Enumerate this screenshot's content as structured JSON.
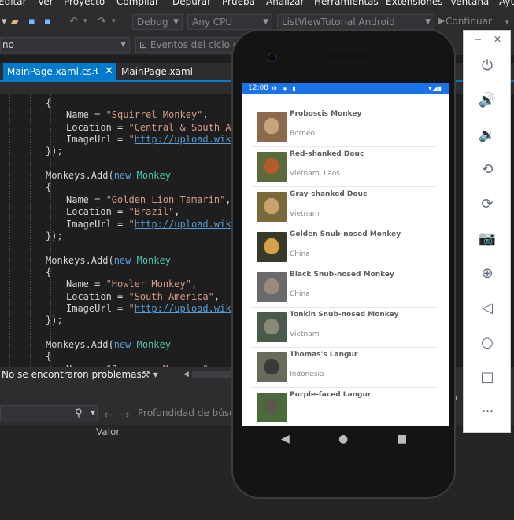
{
  "menubar": {
    "items": [
      "Editar",
      "Ver",
      "Proyecto",
      "Compilar",
      "Depurar",
      "Prueba",
      "Analizar",
      "Herramientas",
      "Extensiones",
      "Ventana",
      "Ayuda"
    ]
  },
  "toolbar": {
    "config": "Debug",
    "platform": "Any CPU",
    "startup_project": "ListViewTutorial.Android",
    "continue_label": "Continuar"
  },
  "navbar": {
    "scope": "no",
    "events": "Eventos del ciclo de"
  },
  "tabs": {
    "active": "MainPage.xaml.cs",
    "pin": "ⴼ",
    "close": "✕",
    "inactive": "MainPage.xaml"
  },
  "code": {
    "lines": [
      {
        "indent": 2,
        "tokens": [
          {
            "c": "c-punc",
            "t": "{"
          }
        ]
      },
      {
        "indent": 3,
        "tokens": [
          {
            "c": "c-punc",
            "t": "Name = "
          },
          {
            "c": "c-str",
            "t": "\"Squirrel Monkey\""
          },
          {
            "c": "c-punc",
            "t": ","
          }
        ]
      },
      {
        "indent": 3,
        "tokens": [
          {
            "c": "c-punc",
            "t": "Location = "
          },
          {
            "c": "c-str",
            "t": "\"Central & South Ameri"
          }
        ]
      },
      {
        "indent": 3,
        "tokens": [
          {
            "c": "c-punc",
            "t": "ImageUrl = "
          },
          {
            "c": "c-str",
            "t": "\""
          },
          {
            "c": "c-link",
            "t": "http://upload.wikimed"
          }
        ]
      },
      {
        "indent": 2,
        "tokens": [
          {
            "c": "c-punc",
            "t": "});"
          }
        ]
      },
      {
        "indent": 0,
        "tokens": []
      },
      {
        "indent": 2,
        "tokens": [
          {
            "c": "c-punc",
            "t": "Monkeys.Add("
          },
          {
            "c": "c-kw",
            "t": "new"
          },
          {
            "c": "c-punc",
            "t": " "
          },
          {
            "c": "c-type",
            "t": "Monkey"
          }
        ]
      },
      {
        "indent": 2,
        "tokens": [
          {
            "c": "c-punc",
            "t": "{"
          }
        ]
      },
      {
        "indent": 3,
        "tokens": [
          {
            "c": "c-punc",
            "t": "Name = "
          },
          {
            "c": "c-str",
            "t": "\"Golden Lion Tamarin\""
          },
          {
            "c": "c-punc",
            "t": ","
          }
        ]
      },
      {
        "indent": 3,
        "tokens": [
          {
            "c": "c-punc",
            "t": "Location = "
          },
          {
            "c": "c-str",
            "t": "\"Brazil\""
          },
          {
            "c": "c-punc",
            "t": ","
          }
        ]
      },
      {
        "indent": 3,
        "tokens": [
          {
            "c": "c-punc",
            "t": "ImageUrl = "
          },
          {
            "c": "c-str",
            "t": "\""
          },
          {
            "c": "c-link",
            "t": "http://upload.wikimed"
          }
        ]
      },
      {
        "indent": 2,
        "tokens": [
          {
            "c": "c-punc",
            "t": "});"
          }
        ]
      },
      {
        "indent": 0,
        "tokens": []
      },
      {
        "indent": 2,
        "tokens": [
          {
            "c": "c-punc",
            "t": "Monkeys.Add("
          },
          {
            "c": "c-kw",
            "t": "new"
          },
          {
            "c": "c-punc",
            "t": " "
          },
          {
            "c": "c-type",
            "t": "Monkey"
          }
        ]
      },
      {
        "indent": 2,
        "tokens": [
          {
            "c": "c-punc",
            "t": "{"
          }
        ]
      },
      {
        "indent": 3,
        "tokens": [
          {
            "c": "c-punc",
            "t": "Name = "
          },
          {
            "c": "c-str",
            "t": "\"Howler Monkey\""
          },
          {
            "c": "c-punc",
            "t": ","
          }
        ]
      },
      {
        "indent": 3,
        "tokens": [
          {
            "c": "c-punc",
            "t": "Location = "
          },
          {
            "c": "c-str",
            "t": "\"South America\""
          },
          {
            "c": "c-punc",
            "t": ","
          }
        ]
      },
      {
        "indent": 3,
        "tokens": [
          {
            "c": "c-punc",
            "t": "ImageUrl = "
          },
          {
            "c": "c-str",
            "t": "\""
          },
          {
            "c": "c-link",
            "t": "http://upload.wikimed"
          }
        ]
      },
      {
        "indent": 2,
        "tokens": [
          {
            "c": "c-punc",
            "t": "});"
          }
        ]
      },
      {
        "indent": 0,
        "tokens": []
      },
      {
        "indent": 2,
        "tokens": [
          {
            "c": "c-punc",
            "t": "Monkeys.Add("
          },
          {
            "c": "c-kw",
            "t": "new"
          },
          {
            "c": "c-punc",
            "t": " "
          },
          {
            "c": "c-type",
            "t": "Monkey"
          }
        ]
      },
      {
        "indent": 2,
        "tokens": [
          {
            "c": "c-punc",
            "t": "{"
          }
        ]
      },
      {
        "indent": 3,
        "tokens": [
          {
            "c": "c-punc",
            "t": "Name = "
          },
          {
            "c": "c-str",
            "t": "\"Japanese Macaque\""
          },
          {
            "c": "c-punc",
            "t": ","
          }
        ]
      }
    ]
  },
  "status": {
    "message": "No se encontraron problemas.",
    "brush_icon": "brush-icon"
  },
  "lower_panel": {
    "search_icon": "search-icon",
    "back_icon": "←",
    "forward_icon": "→",
    "depth_label": "Profundidad de búsqu",
    "value_header": "Valor"
  },
  "phone": {
    "time": "12:08",
    "colors": {
      "statusbar": "#1a73e8"
    },
    "monkeys": [
      {
        "name": "Proboscis Monkey",
        "location": "Borneo",
        "bg": "#8a6a4a",
        "face": "#c7a27a"
      },
      {
        "name": "Red-shanked Douc",
        "location": "Vietnam, Laos",
        "bg": "#5a6a3a",
        "face": "#b55a2a"
      },
      {
        "name": "Gray-shanked Douc",
        "location": "Vietnam",
        "bg": "#7a6a3a",
        "face": "#c9a36a"
      },
      {
        "name": "Golden Snub-nosed Monkey",
        "location": "China",
        "bg": "#3a3a2a",
        "face": "#d4a24a"
      },
      {
        "name": "Black Snub-nosed Monkey",
        "location": "China",
        "bg": "#6a6a6a",
        "face": "#9a8a7a"
      },
      {
        "name": "Tonkin Snub-nosed Monkey",
        "location": "Vietnam",
        "bg": "#4a5a4a",
        "face": "#8a8a7a"
      },
      {
        "name": "Thomas's Langur",
        "location": "Indonesia",
        "bg": "#6a6a5a",
        "face": "#3a3a3a"
      },
      {
        "name": "Purple-faced Langur",
        "location": "",
        "bg": "#4a6a3a",
        "face": "#5a5a4a"
      }
    ]
  },
  "emulator": {
    "minimize": "−",
    "close": "✕",
    "buttons": [
      {
        "name": "power-icon",
        "glyph": "⏻"
      },
      {
        "name": "volume-up-icon",
        "glyph": "🔊"
      },
      {
        "name": "volume-down-icon",
        "glyph": "🔉"
      },
      {
        "name": "rotate-left-icon",
        "glyph": "⟲"
      },
      {
        "name": "rotate-right-icon",
        "glyph": "⟳"
      },
      {
        "name": "camera-icon",
        "glyph": "📷"
      },
      {
        "name": "zoom-icon",
        "glyph": "⊕"
      },
      {
        "name": "back-icon",
        "glyph": "◁"
      },
      {
        "name": "home-icon",
        "glyph": "○"
      },
      {
        "name": "overview-icon",
        "glyph": "□"
      },
      {
        "name": "more-icon",
        "glyph": "•••"
      }
    ]
  }
}
